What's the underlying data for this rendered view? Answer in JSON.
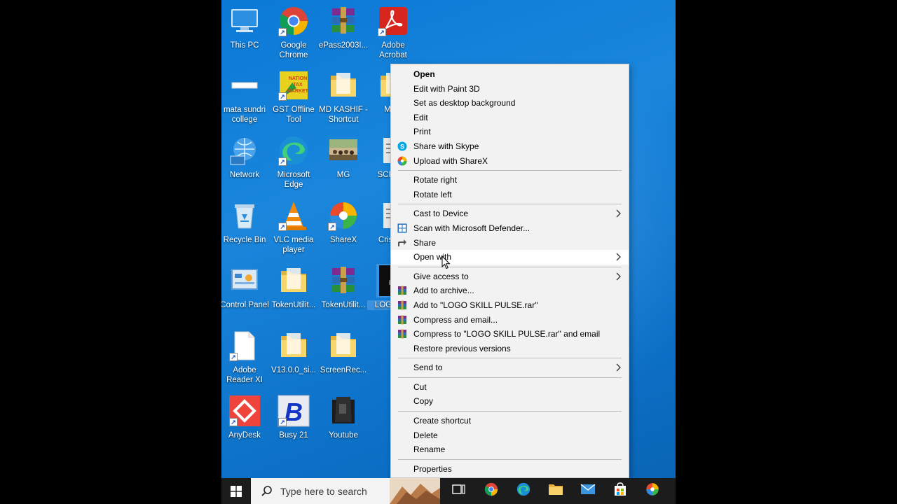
{
  "desktop_icons": [
    {
      "label": "This PC",
      "icon": "this-pc-icon"
    },
    {
      "label": "Google Chrome",
      "icon": "chrome-icon"
    },
    {
      "label": "ePass2003I...",
      "icon": "winrar-icon"
    },
    {
      "label": "Adobe Acrobat",
      "icon": "acrobat-icon"
    },
    {
      "label": "mata sundri college",
      "icon": "image-file-icon"
    },
    {
      "label": "GST Offline Tool",
      "icon": "gst-tool-icon"
    },
    {
      "label": "MD KASHIF - Shortcut",
      "icon": "folder-icon"
    },
    {
      "label": "MCB",
      "icon": "folder-icon"
    },
    {
      "label": "Network",
      "icon": "network-icon"
    },
    {
      "label": "Microsoft Edge",
      "icon": "edge-icon"
    },
    {
      "label": "MG",
      "icon": "photo-icon"
    },
    {
      "label": "SCH NO",
      "icon": "file-icon"
    },
    {
      "label": "Recycle Bin",
      "icon": "recycle-bin-icon"
    },
    {
      "label": "VLC media player",
      "icon": "vlc-icon"
    },
    {
      "label": "ShareX",
      "icon": "sharex-icon"
    },
    {
      "label": "Cris Ror",
      "icon": "file-icon"
    },
    {
      "label": "Control Panel",
      "icon": "control-panel-icon"
    },
    {
      "label": "TokenUtilit...",
      "icon": "folder-icon"
    },
    {
      "label": "TokenUtilit...",
      "icon": "winrar-icon"
    },
    {
      "label": "LOGO PU",
      "icon": "logo-image-icon"
    },
    {
      "label": "Adobe Reader XI",
      "icon": "blank-file-icon"
    },
    {
      "label": "V13.0.0_si...",
      "icon": "folder-icon"
    },
    {
      "label": "ScreenRec...",
      "icon": "folder-icon"
    },
    {
      "label": "AnyDesk",
      "icon": "anydesk-icon"
    },
    {
      "label": "Busy 21",
      "icon": "busy-icon"
    },
    {
      "label": "Youtube",
      "icon": "dark-folder-icon"
    }
  ],
  "context_menu": {
    "groups": [
      [
        {
          "label": "Open",
          "bold": true
        },
        {
          "label": "Edit with Paint 3D"
        },
        {
          "label": "Set as desktop background"
        },
        {
          "label": "Edit"
        },
        {
          "label": "Print"
        },
        {
          "label": "Share with Skype",
          "icon": "skype-icon"
        },
        {
          "label": "Upload with ShareX",
          "icon": "sharex-icon"
        }
      ],
      [
        {
          "label": "Rotate right"
        },
        {
          "label": "Rotate left"
        }
      ],
      [
        {
          "label": "Cast to Device",
          "submenu": true
        },
        {
          "label": "Scan with Microsoft Defender...",
          "icon": "defender-icon"
        },
        {
          "label": "Share",
          "icon": "share-icon"
        },
        {
          "label": "Open with",
          "submenu": true,
          "hover": true
        }
      ],
      [
        {
          "label": "Give access to",
          "submenu": true
        },
        {
          "label": "Add to archive...",
          "icon": "winrar-icon"
        },
        {
          "label": "Add to \"LOGO SKILL PULSE.rar\"",
          "icon": "winrar-icon"
        },
        {
          "label": "Compress and email...",
          "icon": "winrar-icon"
        },
        {
          "label": "Compress to \"LOGO SKILL PULSE.rar\" and email",
          "icon": "winrar-icon"
        },
        {
          "label": "Restore previous versions"
        }
      ],
      [
        {
          "label": "Send to",
          "submenu": true
        }
      ],
      [
        {
          "label": "Cut"
        },
        {
          "label": "Copy"
        }
      ],
      [
        {
          "label": "Create shortcut"
        },
        {
          "label": "Delete"
        },
        {
          "label": "Rename"
        }
      ],
      [
        {
          "label": "Properties"
        }
      ]
    ]
  },
  "taskbar": {
    "search_placeholder": "Type here to search",
    "apps": [
      "task-view-icon",
      "chrome-icon",
      "edge-icon",
      "file-explorer-icon",
      "mail-icon",
      "store-icon",
      "sharex-icon"
    ]
  }
}
